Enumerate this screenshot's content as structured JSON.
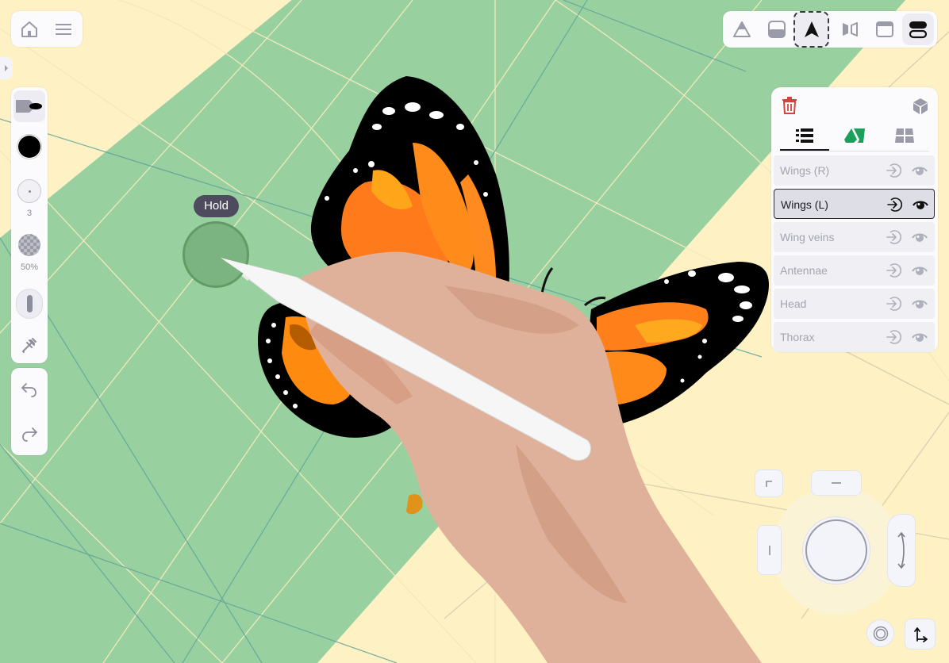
{
  "app": {
    "colors": {
      "canvas_yellow": "#fef1c4",
      "canvas_green": "#99d09f",
      "grid_light": "#f1e9bd",
      "grid_teal": "#5fa39a",
      "panel_bg": "#fbfbfd",
      "icon_gray": "#9a9aa8",
      "delete_red": "#d0453c",
      "accent_green": "#1aa05a",
      "selected_border": "#2a2a30"
    }
  },
  "top_left": {
    "home_icon": "home-icon",
    "menu_icon": "hamburger-menu-icon"
  },
  "side_toggle": {
    "icon": "chevron-right-icon"
  },
  "tools": {
    "brush_icon": "brush-icon",
    "color": "#000000",
    "size_value": "3",
    "opacity_value": "50%",
    "stroke_icon": "stroke-shape-icon",
    "eyedropper_icon": "eyedropper-icon"
  },
  "history": {
    "undo_icon": "undo-icon",
    "redo_icon": "redo-icon"
  },
  "top_toolbar": {
    "items": [
      {
        "name": "perspective-tool",
        "icon": "triangle-icon"
      },
      {
        "name": "fill-tool",
        "icon": "half-rect-icon"
      },
      {
        "name": "navigate-tool",
        "icon": "arrow-pointer-icon",
        "active": true
      },
      {
        "name": "mirror-tool",
        "icon": "mirror-icon"
      },
      {
        "name": "frame-tool",
        "icon": "window-icon"
      },
      {
        "name": "split-view-tool",
        "icon": "stack-icon",
        "selected": true
      }
    ]
  },
  "layers_panel": {
    "delete_icon": "trash-icon",
    "cube_icon": "cube-icon",
    "tabs": [
      {
        "name": "layers-list",
        "icon": "list-icon",
        "active": true
      },
      {
        "name": "materials",
        "icon": "green-shapes-icon"
      },
      {
        "name": "grid-view",
        "icon": "grid-icon"
      }
    ],
    "layers": [
      {
        "label": "Wings (R)",
        "selected": false
      },
      {
        "label": "Wings (L)",
        "selected": true
      },
      {
        "label": "Wing veins",
        "selected": false
      },
      {
        "label": "Antennae",
        "selected": false
      },
      {
        "label": "Head",
        "selected": false
      },
      {
        "label": "Thorax",
        "selected": false
      }
    ]
  },
  "hold_tooltip": {
    "label": "Hold"
  },
  "joystick": {
    "corner_icon": "corner-icon",
    "top_key_icon": "horizontal-bar-icon",
    "left_key_icon": "vertical-bar-icon",
    "right_key_icon": "vertical-arrows-icon",
    "target_icon": "target-icon",
    "axis_icon": "axis-arrows-icon"
  }
}
